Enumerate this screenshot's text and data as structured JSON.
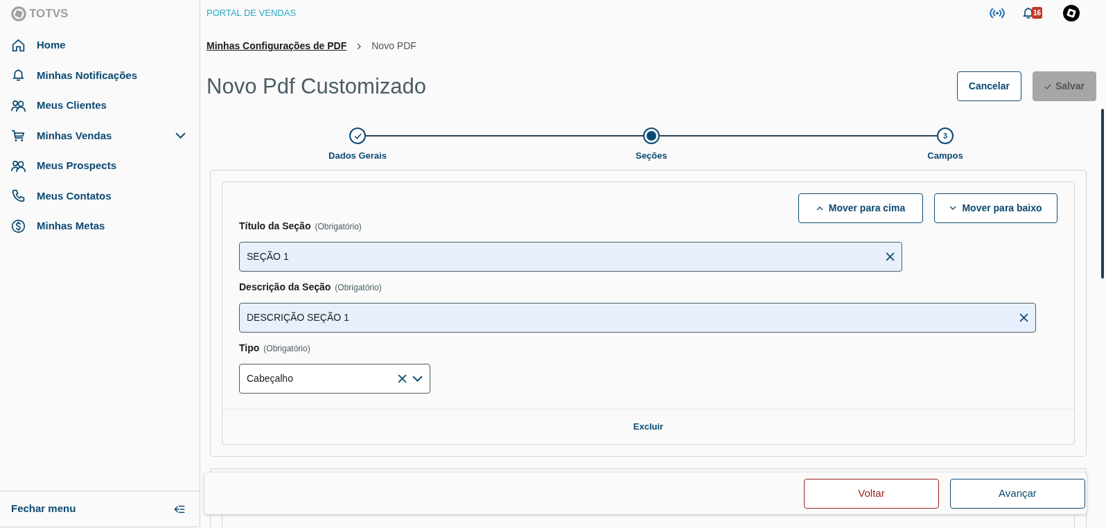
{
  "brand": {
    "name": "TOTVS"
  },
  "sidebar": {
    "items": [
      {
        "label": "Home",
        "kind": "link"
      },
      {
        "label": "Minhas Notificações",
        "kind": "link"
      },
      {
        "label": "Meus Clientes",
        "kind": "link"
      },
      {
        "label": "Minhas Vendas",
        "kind": "group",
        "expanded": false
      },
      {
        "label": "Meus Prospects",
        "kind": "link"
      },
      {
        "label": "Meus Contatos",
        "kind": "link"
      },
      {
        "label": "Minhas Metas",
        "kind": "link"
      }
    ],
    "footer": "Fechar menu"
  },
  "header": {
    "title": "PORTAL DE VENDAS",
    "notifications": "16"
  },
  "breadcrumb": [
    {
      "label": "Minhas Configurações de PDF",
      "kind": "link"
    },
    {
      "label": "Novo PDF",
      "kind": "current"
    }
  ],
  "page": {
    "title": "Novo Pdf Customizado",
    "actions": [
      {
        "label": "Cancelar",
        "disabled": false
      },
      {
        "label": "Salvar",
        "disabled": true
      }
    ]
  },
  "stepper": [
    {
      "label": "Dados Gerais",
      "completed": true,
      "selected": false
    },
    {
      "label": "Seções",
      "selected": true
    },
    {
      "label": "Campos",
      "completed": false,
      "selected": false,
      "number": "3"
    }
  ],
  "section": {
    "move_buttons": [
      {
        "label": "Mover para cima",
        "kind": "up"
      },
      {
        "label": "Mover para baixo",
        "kind": "down"
      }
    ],
    "fields": [
      {
        "label": "Título da Seção",
        "hint": "(Obrigatório)",
        "value": "SEÇÃO 1",
        "kind": "short"
      },
      {
        "label": "Descrição da Seção",
        "hint": "(Obrigatório)",
        "value": "DESCRIÇÃO SEÇÃO 1",
        "kind": "long"
      },
      {
        "label": "Tipo",
        "hint": "(Obrigatório)",
        "value": "Cabeçalho",
        "kind": "select"
      }
    ],
    "delete": "Excluir"
  },
  "footer_buttons": [
    {
      "label": "Voltar",
      "kind": "back"
    },
    {
      "label": "Avançar",
      "kind": "next"
    }
  ]
}
